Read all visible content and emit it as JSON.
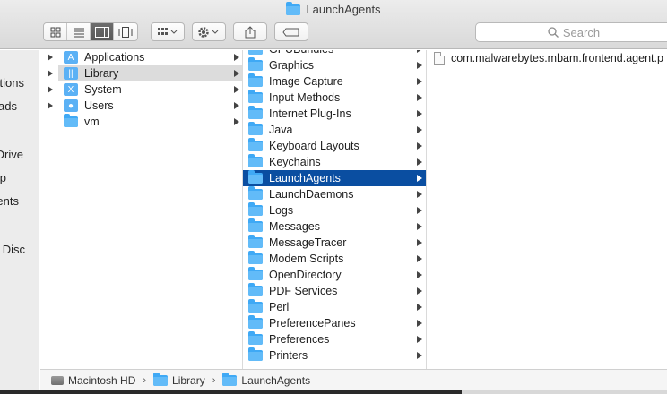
{
  "window": {
    "title": "LaunchAgents"
  },
  "toolbar": {
    "view_icons": [
      "icon-view-icon",
      "list-view-icon",
      "column-view-icon",
      "coverflow-view-icon"
    ],
    "search_placeholder": "Search"
  },
  "sidebar": {
    "items": [
      "ations",
      "ads",
      "Drive",
      "p",
      "ents",
      "Disc"
    ]
  },
  "column1": {
    "items": [
      {
        "label": "Applications",
        "icon": "applications-icon",
        "arrow": true
      },
      {
        "label": "Library",
        "icon": "folder-icon",
        "arrow": true,
        "selected": true
      },
      {
        "label": "System",
        "icon": "system-icon",
        "arrow": true
      },
      {
        "label": "Users",
        "icon": "users-icon",
        "arrow": true
      },
      {
        "label": "vm",
        "icon": "folder-icon",
        "arrow": true
      }
    ]
  },
  "column2": {
    "items": [
      {
        "label": "GPUBundles"
      },
      {
        "label": "Graphics"
      },
      {
        "label": "Image Capture"
      },
      {
        "label": "Input Methods"
      },
      {
        "label": "Internet Plug-Ins"
      },
      {
        "label": "Java"
      },
      {
        "label": "Keyboard Layouts"
      },
      {
        "label": "Keychains"
      },
      {
        "label": "LaunchAgents",
        "selected": true
      },
      {
        "label": "LaunchDaemons"
      },
      {
        "label": "Logs"
      },
      {
        "label": "Messages"
      },
      {
        "label": "MessageTracer"
      },
      {
        "label": "Modem Scripts"
      },
      {
        "label": "OpenDirectory"
      },
      {
        "label": "PDF Services"
      },
      {
        "label": "Perl"
      },
      {
        "label": "PreferencePanes"
      },
      {
        "label": "Preferences"
      },
      {
        "label": "Printers"
      }
    ]
  },
  "column3": {
    "items": [
      {
        "label": "com.malwarebytes.mbam.frontend.agent.p"
      }
    ]
  },
  "pathbar": {
    "segments": [
      "Macintosh HD",
      "Library",
      "LaunchAgents"
    ]
  },
  "colors": {
    "selection": "#0a4ea1",
    "folder": "#3fa9f5"
  }
}
